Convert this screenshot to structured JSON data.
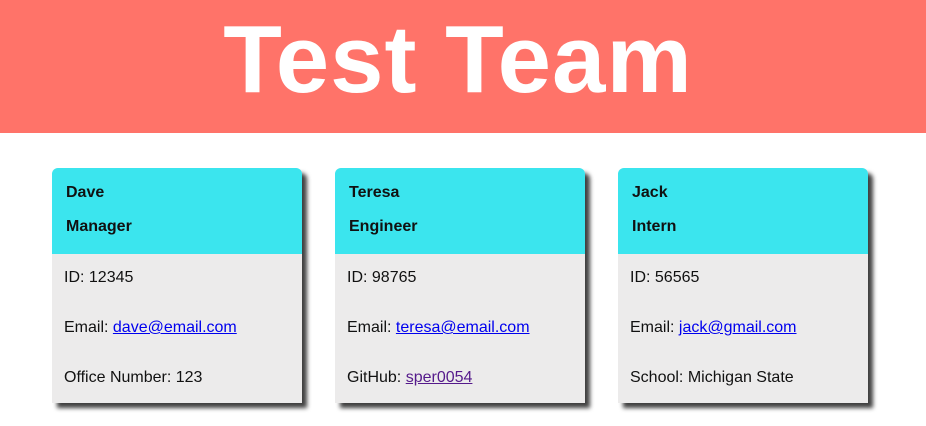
{
  "header": {
    "title": "Test Team"
  },
  "cards": [
    {
      "name": "Dave",
      "role": "Manager",
      "id_label": "ID:",
      "id": "12345",
      "email_label": "Email:",
      "email": "dave@email.com",
      "extra_label": "Office Number:",
      "extra": "123"
    },
    {
      "name": "Teresa",
      "role": "Engineer",
      "id_label": "ID:",
      "id": "98765",
      "email_label": "Email:",
      "email": "teresa@email.com",
      "extra_label": "GitHub:",
      "extra": "sper0054"
    },
    {
      "name": "Jack",
      "role": "Intern",
      "id_label": "ID:",
      "id": "56565",
      "email_label": "Email:",
      "email": "jack@gmail.com",
      "extra_label": "School:",
      "extra": "Michigan State"
    }
  ],
  "colors": {
    "banner": "#ff7369",
    "card_header": "#3be5ee",
    "card_body": "#ecebeb",
    "link": "#0000ee",
    "visited_link": "#551a8b"
  }
}
